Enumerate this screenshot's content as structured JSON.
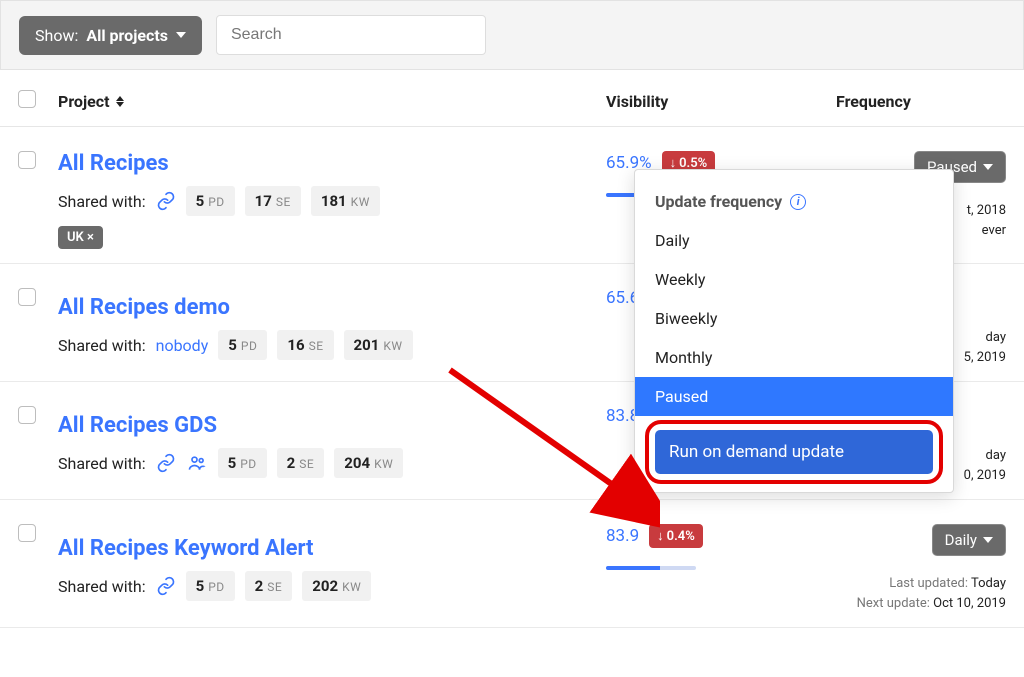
{
  "topbar": {
    "show_label": "Show:",
    "show_value": "All projects",
    "search_placeholder": "Search"
  },
  "headers": {
    "project": "Project",
    "visibility": "Visibility",
    "frequency": "Frequency"
  },
  "stat_labels": {
    "pd": "PD",
    "se": "SE",
    "kw": "KW"
  },
  "shared_label": "Shared with:",
  "rows": [
    {
      "title": "All Recipes",
      "share_mode": "link",
      "stats": {
        "pd": "5",
        "se": "17",
        "kw": "181"
      },
      "tag": "UK ×",
      "visibility": {
        "pct": "65.9%",
        "delta": "0.5%"
      },
      "freq_label": "Paused",
      "meta": {
        "last_label": "",
        "last_val": "t, 2018",
        "next_label": "",
        "next_val": "ever"
      }
    },
    {
      "title": "All Recipes demo",
      "share_mode": "nobody",
      "nobody_text": "nobody",
      "stats": {
        "pd": "5",
        "se": "16",
        "kw": "201"
      },
      "visibility": {
        "pct": "65.6"
      },
      "meta": {
        "last_val": "day",
        "next_val": "5, 2019"
      }
    },
    {
      "title": "All Recipes GDS",
      "share_mode": "link_people",
      "stats": {
        "pd": "5",
        "se": "2",
        "kw": "204"
      },
      "visibility": {
        "pct": "83.8"
      },
      "meta": {
        "last_val": "day",
        "next_val": "0, 2019"
      }
    },
    {
      "title": "All Recipes Keyword Alert",
      "share_mode": "link",
      "stats": {
        "pd": "5",
        "se": "2",
        "kw": "202"
      },
      "visibility": {
        "pct": "83.9",
        "delta": "0.4%"
      },
      "freq_label": "Daily",
      "meta": {
        "last_label": "Last updated:",
        "last_val": "Today",
        "next_label": "Next update:",
        "next_val": "Oct 10, 2019"
      }
    }
  ],
  "dropdown": {
    "header": "Update frequency",
    "items": [
      "Daily",
      "Weekly",
      "Biweekly",
      "Monthly",
      "Paused"
    ],
    "selected": "Paused",
    "run_label": "Run on demand update"
  }
}
